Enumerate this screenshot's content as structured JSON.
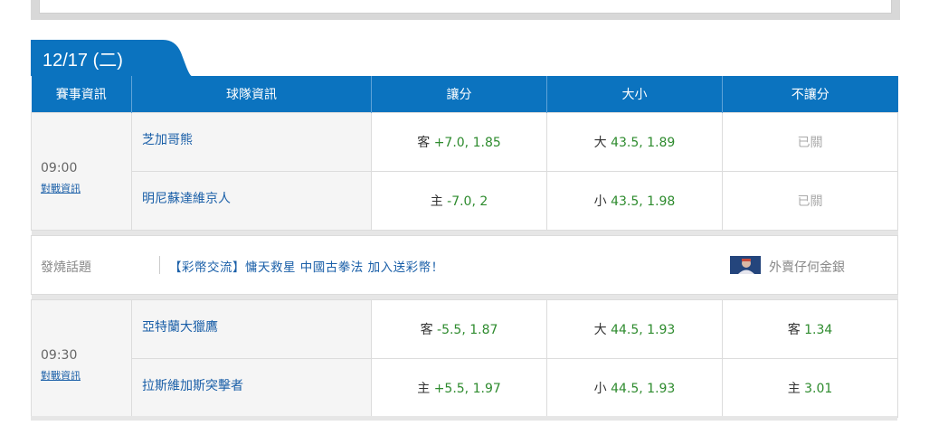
{
  "date_tab": "12/17 (二)",
  "headers": [
    "賽事資訊",
    "球隊資訊",
    "讓分",
    "大小",
    "不讓分"
  ],
  "games": [
    {
      "time": "09:00",
      "link": "對戰資訊",
      "away": {
        "team": "芝加哥熊",
        "spread_side": "客",
        "spread": "+7.0,",
        "spread_odds": "1.85",
        "total_side": "大",
        "total": "43.5,",
        "total_odds": "1.89",
        "ml": "已關"
      },
      "home": {
        "team": "明尼蘇達維京人",
        "spread_side": "主",
        "spread": "-7.0,",
        "spread_odds": "2",
        "total_side": "小",
        "total": "43.5,",
        "total_odds": "1.98",
        "ml": "已關"
      }
    },
    {
      "time": "09:30",
      "link": "對戰資訊",
      "away": {
        "team": "亞特蘭大獵鷹",
        "spread_side": "客",
        "spread": "-5.5,",
        "spread_odds": "1.87",
        "total_side": "大",
        "total": "44.5,",
        "total_odds": "1.93",
        "ml_side": "客",
        "ml": "1.34"
      },
      "home": {
        "team": "拉斯維加斯突擊者",
        "spread_side": "主",
        "spread": "+5.5,",
        "spread_odds": "1.97",
        "total_side": "小",
        "total": "44.5,",
        "total_odds": "1.93",
        "ml_side": "主",
        "ml": "3.01"
      }
    }
  ],
  "hot_topic": {
    "label": "發燒話題",
    "link": "【彩幣交流】慵天救星 中國古拳法 加入送彩幣！",
    "user": "外賣仔何金銀"
  },
  "colors": {
    "header_bg": "#0b73bf",
    "link": "#1a5fa8",
    "odds": "#2e8b2e"
  }
}
